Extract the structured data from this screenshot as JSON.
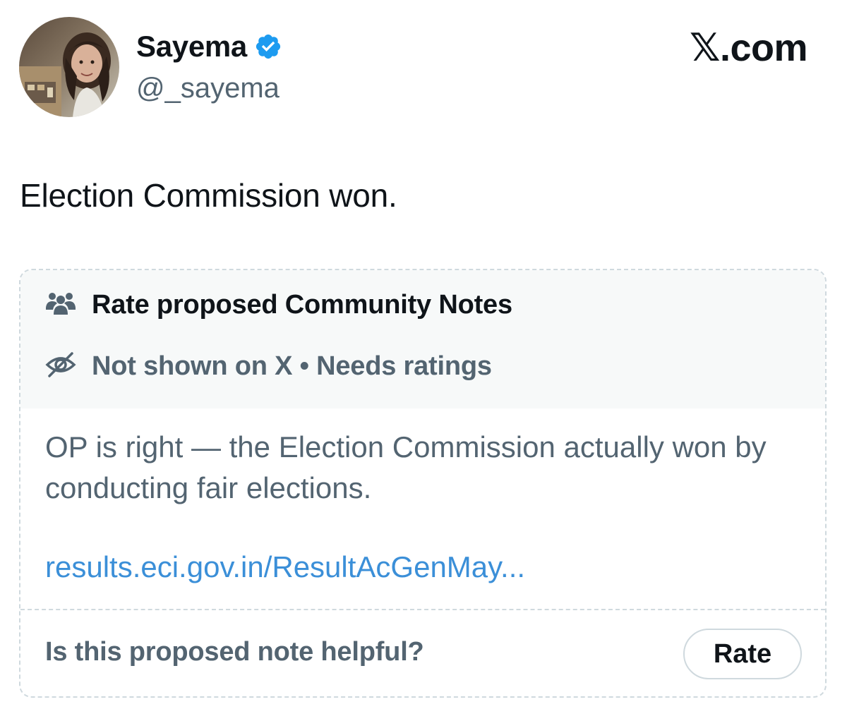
{
  "author": {
    "display_name": "Sayema",
    "handle": "@_sayema",
    "avatar_icon": "profile-photo",
    "verified_icon": "verified-badge-icon"
  },
  "brand": {
    "label": "𝕏.com"
  },
  "tweet": {
    "text": "Election Commission won."
  },
  "community_note": {
    "title": "Rate proposed Community Notes",
    "title_icon": "people-icon",
    "status": "Not shown on X • Needs ratings",
    "status_icon": "eye-off-icon",
    "body": "OP is right — the Election Commission actually won by conducting fair elections.",
    "link": "results.eci.gov.in/ResultAcGenMay...",
    "helpful_question": "Is this proposed note helpful?",
    "rate_label": "Rate"
  },
  "colors": {
    "text_primary": "#0f1419",
    "text_secondary": "#536471",
    "link": "#3b8fd8",
    "verified": "#1d9bf0",
    "border": "#cfd9de",
    "header_bg": "#f7f9f9"
  }
}
